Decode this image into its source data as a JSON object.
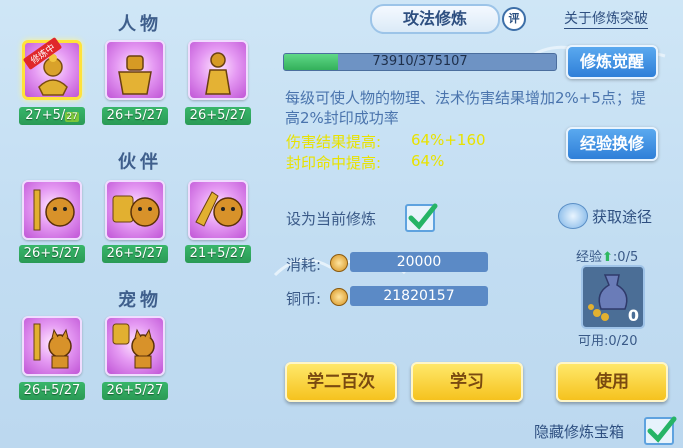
{
  "sections": {
    "character": "人物",
    "partner": "伙伴",
    "pet": "宠物"
  },
  "character_slots": [
    {
      "level": "27+5/",
      "badge": "修炼中",
      "extra": "27"
    },
    {
      "level": "26+5/27"
    },
    {
      "level": "26+5/27"
    }
  ],
  "partner_slots": [
    {
      "level": "26+5/27"
    },
    {
      "level": "26+5/27"
    },
    {
      "level": "21+5/27"
    }
  ],
  "pet_slots": [
    {
      "level": "26+5/27"
    },
    {
      "level": "26+5/27"
    }
  ],
  "panel": {
    "title": "攻法修炼",
    "rate_label": "评",
    "about_link": "关于修炼突破",
    "progress_text": "73910/375107",
    "progress_fraction": 0.197,
    "awaken_button": "修炼觉醒",
    "description": "每级可使人物的物理、法术伤害结果增加2%+5点；提高2%封印成功率",
    "stat1_label": "伤害结果提高:",
    "stat1_value": "64%+160",
    "stat2_label": "封印命中提高:",
    "stat2_value": "64%",
    "exchange_button": "经验换修",
    "set_current_label": "设为当前修炼",
    "obtain_label": "获取途径",
    "cost_label": "消耗:",
    "cost_value": "20000",
    "coin_label": "铜币:",
    "coin_value": "21820157",
    "exp_label": "经验",
    "exp_value": ":0/5",
    "item_count": "0",
    "usable_label": "可用:0/20",
    "learn200_button": "学二百次",
    "learn_button": "学习",
    "use_button": "使用",
    "hide_chest_label": "隐藏修炼宝箱"
  },
  "colors": {
    "stat_yellow": "#e8e200",
    "progress_green": "#3dbe63",
    "accent_blue": "#2f7fd8"
  }
}
